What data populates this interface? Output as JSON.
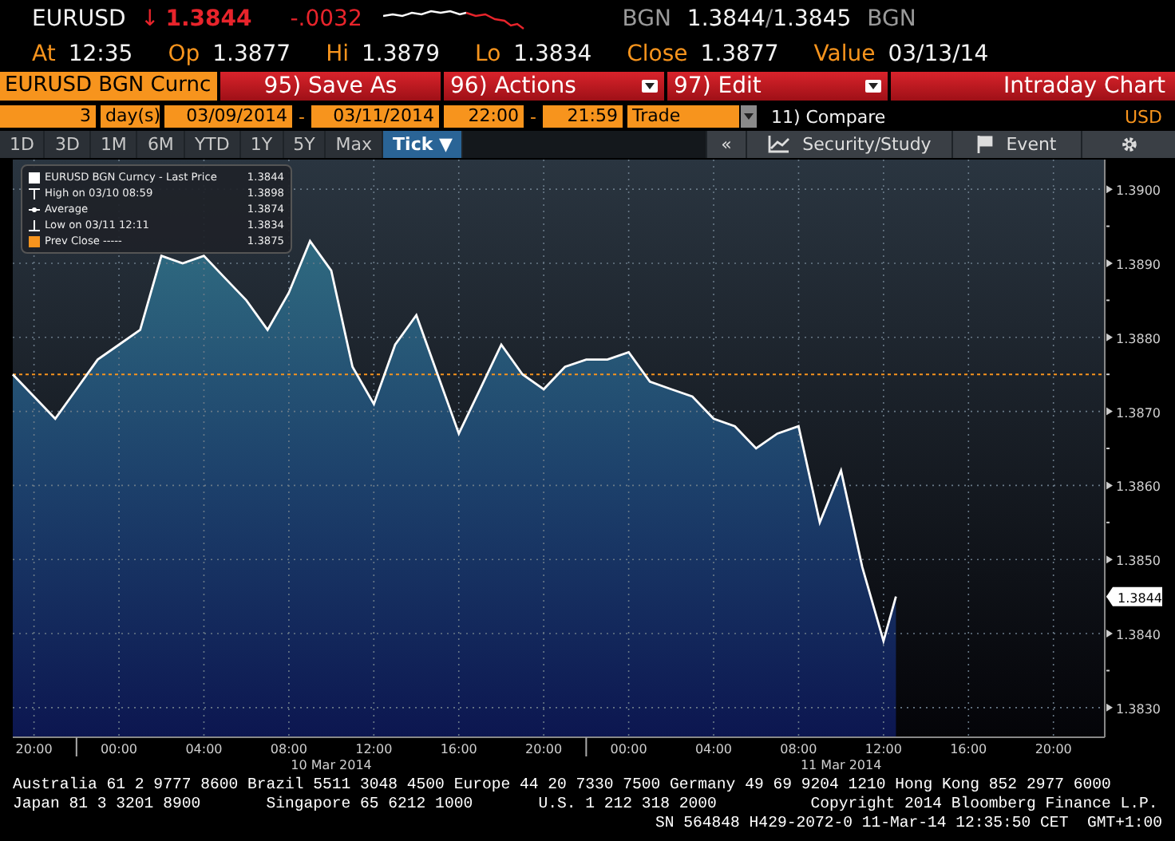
{
  "quote": {
    "ticker": "EURUSD",
    "arrow": "↓",
    "last": "1.3844",
    "change": "-.0032",
    "source": "BGN",
    "bid_ask": "1.3844",
    "sep": "/",
    "ask": "1.3845",
    "source2": "BGN"
  },
  "stats": [
    {
      "label": "At",
      "value": "12:35"
    },
    {
      "label": "Op",
      "value": "1.3877"
    },
    {
      "label": "Hi",
      "value": "1.3879"
    },
    {
      "label": "Lo",
      "value": "1.3834"
    },
    {
      "label": "Close",
      "value": "1.3877"
    },
    {
      "label": "Value",
      "value": "03/13/14"
    }
  ],
  "toolbar": {
    "security": "EURUSD BGN Curnc",
    "buttons": [
      {
        "number": "95)",
        "label": "Save As",
        "dropdown": false
      },
      {
        "number": "96)",
        "label": "Actions",
        "dropdown": true
      },
      {
        "number": "97)",
        "label": "Edit",
        "dropdown": true
      }
    ],
    "title": "Intraday Chart"
  },
  "range": {
    "count": "3",
    "unit": "day(s)",
    "start_date": "03/09/2014",
    "date_sep": "-",
    "end_date": "03/11/2014",
    "start_time": "22:00",
    "time_sep": "-",
    "end_time": "21:59",
    "event": "Trade",
    "compare": "11) Compare",
    "currency": "USD"
  },
  "periods": [
    {
      "label": "1D",
      "selected": false
    },
    {
      "label": "3D",
      "selected": false
    },
    {
      "label": "1M",
      "selected": false
    },
    {
      "label": "6M",
      "selected": false
    },
    {
      "label": "YTD",
      "selected": false
    },
    {
      "label": "1Y",
      "selected": false
    },
    {
      "label": "5Y",
      "selected": false
    },
    {
      "label": "Max",
      "selected": false
    },
    {
      "label": "Tick ▼",
      "selected": true
    }
  ],
  "panel_buttons": {
    "collapse": "«",
    "study": "Security/Study",
    "event": "Event"
  },
  "legend": [
    {
      "kind": "last",
      "value": "1.3844"
    },
    {
      "kind": "high",
      "label": "High on 03/10 08:59",
      "value": "1.3898"
    },
    {
      "kind": "average",
      "label": "Average",
      "value": "1.3874"
    },
    {
      "kind": "low",
      "label": "Low on 03/11 12:11",
      "value": "1.3834"
    },
    {
      "kind": "prev",
      "label": "Prev Close -----",
      "value": "1.3875"
    }
  ],
  "price_tag": "1.3844",
  "date_labels": [
    "10 Mar 2014",
    "11 Mar 2014"
  ],
  "chart_data": {
    "type": "area",
    "grid": true,
    "x": [
      "2014-03-09T19:00",
      "2014-03-09T20:00",
      "2014-03-09T21:00",
      "2014-03-09T22:00",
      "2014-03-09T23:00",
      "2014-03-10T00:00",
      "2014-03-10T01:00",
      "2014-03-10T02:00",
      "2014-03-10T03:00",
      "2014-03-10T04:00",
      "2014-03-10T05:00",
      "2014-03-10T06:00",
      "2014-03-10T07:00",
      "2014-03-10T08:00",
      "2014-03-10T09:00",
      "2014-03-10T10:00",
      "2014-03-10T11:00",
      "2014-03-10T12:00",
      "2014-03-10T13:00",
      "2014-03-10T14:00",
      "2014-03-10T15:00",
      "2014-03-10T16:00",
      "2014-03-10T17:00",
      "2014-03-10T18:00",
      "2014-03-10T19:00",
      "2014-03-10T20:00",
      "2014-03-10T21:00",
      "2014-03-10T22:00",
      "2014-03-10T23:00",
      "2014-03-11T00:00",
      "2014-03-11T01:00",
      "2014-03-11T02:00",
      "2014-03-11T03:00",
      "2014-03-11T04:00",
      "2014-03-11T05:00",
      "2014-03-11T06:00",
      "2014-03-11T07:00",
      "2014-03-11T08:00",
      "2014-03-11T09:00",
      "2014-03-11T10:00",
      "2014-03-11T11:00",
      "2014-03-11T12:00",
      "2014-03-11T12:35"
    ],
    "series": [
      {
        "name": "EURUSD BGN Curncy - Last Price",
        "color": "#ffffff",
        "values": [
          1.3875,
          1.3872,
          1.3869,
          1.3873,
          1.3877,
          1.3879,
          1.3881,
          1.3891,
          1.389,
          1.3891,
          1.3888,
          1.3885,
          1.3881,
          1.3886,
          1.3893,
          1.3889,
          1.3876,
          1.3871,
          1.3879,
          1.3883,
          1.3875,
          1.3867,
          1.3873,
          1.3879,
          1.3875,
          1.3873,
          1.3876,
          1.3877,
          1.3877,
          1.3878,
          1.3874,
          1.3873,
          1.3872,
          1.3869,
          1.3868,
          1.3865,
          1.3867,
          1.3868,
          1.3855,
          1.3862,
          1.3849,
          1.3839,
          1.3845
        ]
      }
    ],
    "xlim": [
      "2014-03-09T19:00",
      "2014-03-11T22:25"
    ],
    "ylim": [
      1.3826,
      1.3904
    ],
    "xticks": [
      {
        "value": "2014-03-09T20:00",
        "label": "20:00"
      },
      {
        "value": "2014-03-10T00:00",
        "label": "00:00"
      },
      {
        "value": "2014-03-10T04:00",
        "label": "04:00"
      },
      {
        "value": "2014-03-10T08:00",
        "label": "08:00"
      },
      {
        "value": "2014-03-10T12:00",
        "label": "12:00"
      },
      {
        "value": "2014-03-10T16:00",
        "label": "16:00"
      },
      {
        "value": "2014-03-10T20:00",
        "label": "20:00"
      },
      {
        "value": "2014-03-11T00:00",
        "label": "00:00"
      },
      {
        "value": "2014-03-11T04:00",
        "label": "04:00"
      },
      {
        "value": "2014-03-11T08:00",
        "label": "08:00"
      },
      {
        "value": "2014-03-11T12:00",
        "label": "12:00"
      },
      {
        "value": "2014-03-11T16:00",
        "label": "16:00"
      },
      {
        "value": "2014-03-11T20:00",
        "label": "20:00"
      }
    ],
    "yticks": [
      {
        "value": 1.383,
        "label": "1.3830"
      },
      {
        "value": 1.384,
        "label": "1.3840"
      },
      {
        "value": 1.385,
        "label": "1.3850"
      },
      {
        "value": 1.386,
        "label": "1.3860"
      },
      {
        "value": 1.387,
        "label": "1.3870"
      },
      {
        "value": 1.388,
        "label": "1.3880"
      },
      {
        "value": 1.389,
        "label": "1.3890"
      },
      {
        "value": 1.39,
        "label": "1.3900"
      }
    ],
    "ref_lines": [
      {
        "axis": "y",
        "value": 1.3875,
        "color": "#f7941d"
      }
    ]
  },
  "footer": [
    "Australia 61 2 9777 8600 Brazil 5511 3048 4500 Europe 44 20 7330 7500 Germany 49 69 9204 1210 Hong Kong 852 2977 6000",
    "Japan 81 3 3201 8900       Singapore 65 6212 1000       U.S. 1 212 318 2000          Copyright 2014 Bloomberg Finance L.P.",
    "SN 564848 H429-2072-0 11-Mar-14 12:35:50 CET  GMT+1:00"
  ]
}
